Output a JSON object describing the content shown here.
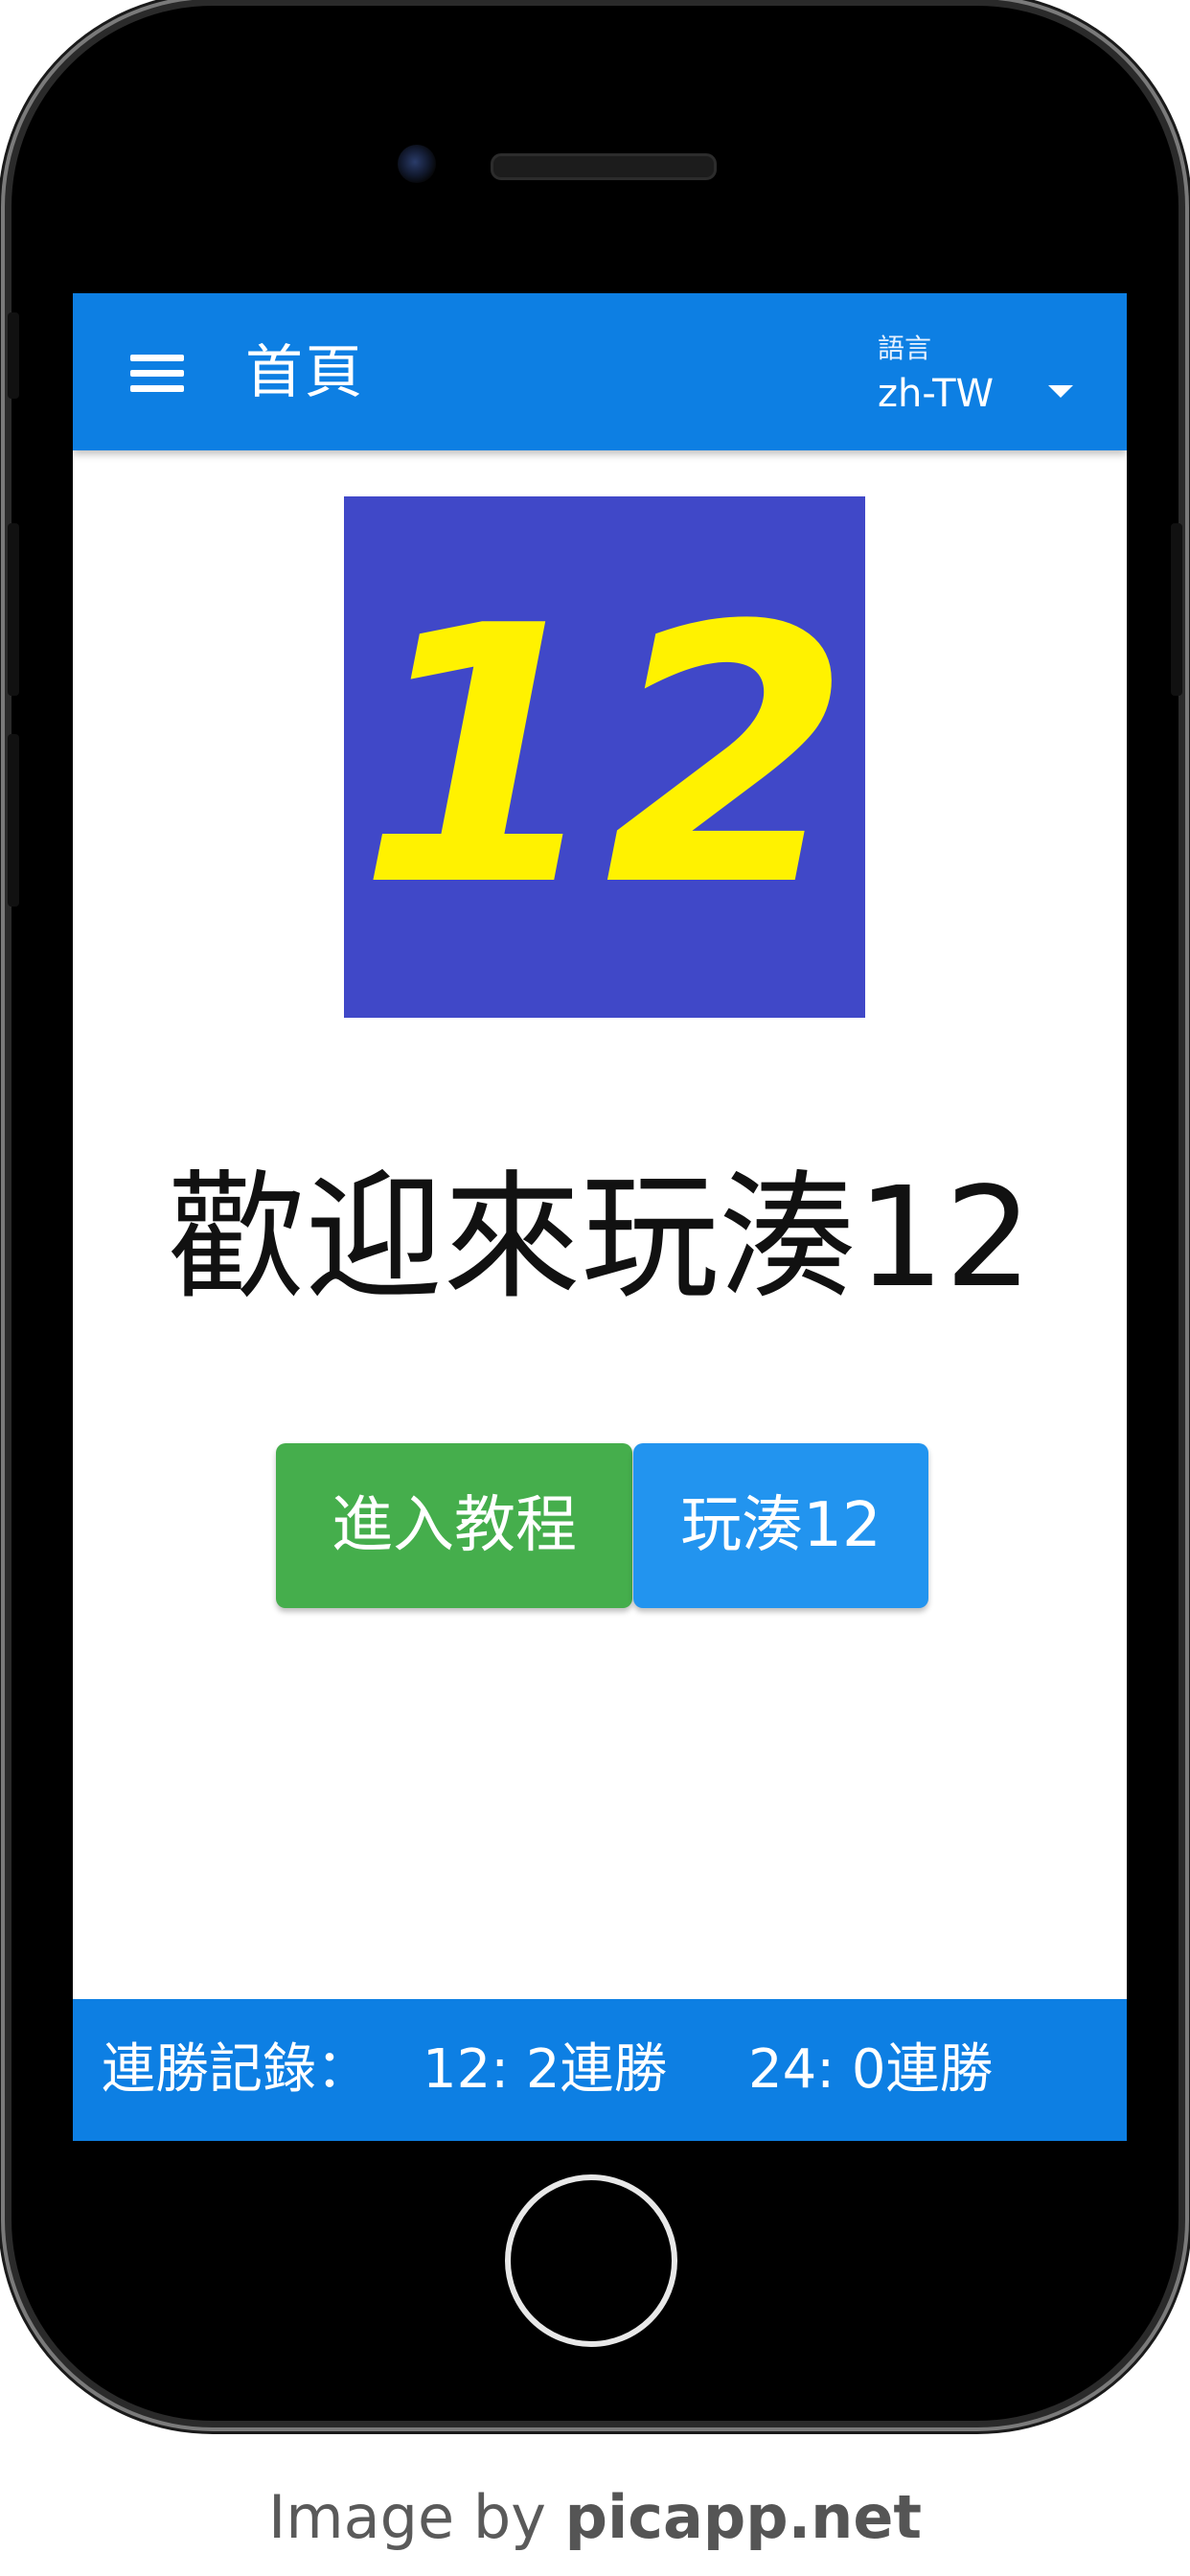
{
  "app_bar": {
    "title": "首頁",
    "menu_icon": "hamburger-menu-icon",
    "language": {
      "label": "語言",
      "value": "zh-TW",
      "dropdown_icon": "caret-down-icon"
    },
    "color": "#0d7fe3"
  },
  "logo": {
    "text": "12",
    "background_color": "#4048c8",
    "text_color": "#fff200"
  },
  "main": {
    "welcome": "歡迎來玩湊12"
  },
  "buttons": {
    "tutorial": {
      "label": "進入教程",
      "color": "#45ae4c"
    },
    "play": {
      "label": "玩湊12",
      "color": "#2294ef"
    }
  },
  "footer": {
    "label": "連勝記錄：",
    "streak_12": "12: 2連勝",
    "streak_24": "24: 0連勝"
  },
  "credit": {
    "prefix": "Image by",
    "site": "picapp.net"
  }
}
